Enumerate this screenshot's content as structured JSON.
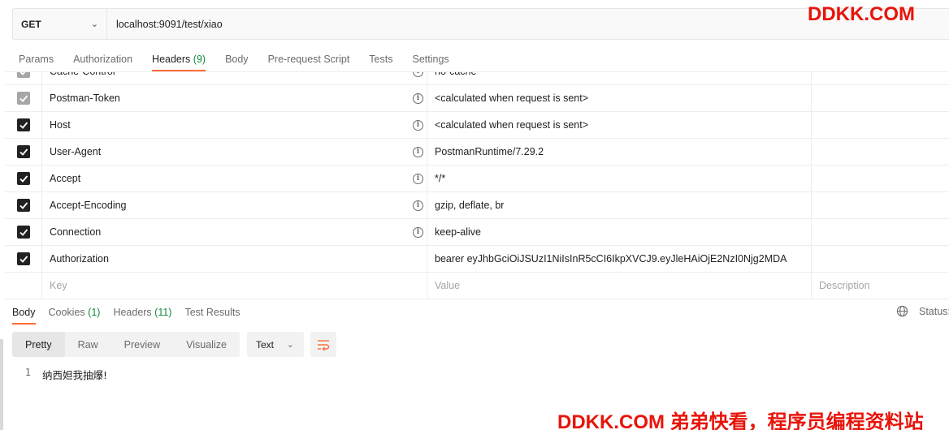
{
  "request": {
    "method": "GET",
    "url": "localhost:9091/test/xiao"
  },
  "request_tabs": [
    {
      "label": "Params"
    },
    {
      "label": "Authorization"
    },
    {
      "label": "Headers",
      "count": "(9)"
    },
    {
      "label": "Body"
    },
    {
      "label": "Pre-request Script"
    },
    {
      "label": "Tests"
    },
    {
      "label": "Settings"
    }
  ],
  "headers": {
    "rows": [
      {
        "key": "Cache-Control",
        "value": "no-cache",
        "info": "i"
      },
      {
        "key": "Postman-Token",
        "value": "<calculated when request is sent>",
        "info": "i"
      },
      {
        "key": "Host",
        "value": "<calculated when request is sent>",
        "info": "i"
      },
      {
        "key": "User-Agent",
        "value": "PostmanRuntime/7.29.2",
        "info": "i"
      },
      {
        "key": "Accept",
        "value": "*/*",
        "info": "i"
      },
      {
        "key": "Accept-Encoding",
        "value": "gzip, deflate, br",
        "info": "i"
      },
      {
        "key": "Connection",
        "value": "keep-alive",
        "info": "i"
      },
      {
        "key": "Authorization",
        "value": "bearer eyJhbGciOiJSUzI1NiIsInR5cCI6IkpXVCJ9.eyJleHAiOjE2NzI0Njg2MDA"
      }
    ],
    "placeholder": {
      "key": "Key",
      "value": "Value",
      "description": "Description"
    }
  },
  "response_tabs": [
    {
      "label": "Body"
    },
    {
      "label": "Cookies",
      "count": "(1)"
    },
    {
      "label": "Headers",
      "count": "(11)"
    },
    {
      "label": "Test Results"
    }
  ],
  "status_label": "Status:",
  "view_modes": [
    "Pretty",
    "Raw",
    "Preview",
    "Visualize"
  ],
  "format": "Text",
  "response_body": {
    "line_number": "1",
    "text": "纳西妲我抽爆!"
  },
  "watermarks": {
    "top": "DDKK.COM",
    "bottom": "DDKK.COM 弟弟快看，程序员编程资料站"
  },
  "colors": {
    "accent": "#ff6c37",
    "count": "#0f8a3d",
    "watermark": "#e8140a"
  }
}
